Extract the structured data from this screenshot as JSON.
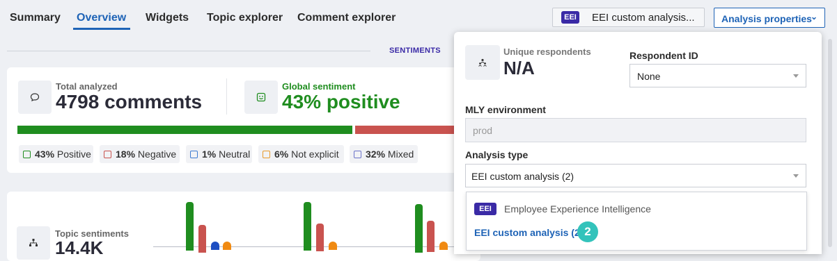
{
  "nav": {
    "tabs": [
      {
        "label": "Summary"
      },
      {
        "label": "Overview",
        "active": true
      },
      {
        "label": "Widgets"
      },
      {
        "label": "Topic explorer"
      },
      {
        "label": "Comment explorer"
      }
    ],
    "context_badge": "EEI",
    "context_text": "EEI custom analysis...",
    "properties_button": "Analysis properties",
    "properties_chevron": "⌄"
  },
  "section_label": "SENTIMENTS",
  "summary_card": {
    "total_label": "Total analyzed",
    "total_value": "4798 comments",
    "global_label": "Global sentiment",
    "global_value": "43% positive",
    "bar": [
      {
        "name": "positive",
        "value": 43,
        "color": "#1f8d1f"
      },
      {
        "name": "negative",
        "value": 18,
        "color": "#c9534f"
      }
    ],
    "chips": [
      {
        "percent": "43%",
        "label": "Positive",
        "color": "#1f8d1f"
      },
      {
        "percent": "18%",
        "label": "Negative",
        "color": "#c9534f"
      },
      {
        "percent": "1%",
        "label": "Neutral",
        "color": "#3d7bd1"
      },
      {
        "percent": "6%",
        "label": "Not explicit",
        "color": "#e89a2a"
      },
      {
        "percent": "32%",
        "label": "Mixed",
        "color": "#6b73c9"
      }
    ]
  },
  "topic_card": {
    "label": "Topic sentiments",
    "value": "14.4K",
    "colors": {
      "positive": "#1f8d1f",
      "negative": "#c9534f",
      "neutral": "#1e4fc2",
      "not_explicit": "#f08a12"
    }
  },
  "panel": {
    "unique_label": "Unique respondents",
    "unique_value": "N/A",
    "respondent_id_label": "Respondent ID",
    "respondent_id_value": "None",
    "env_label": "MLY environment",
    "env_value": "prod",
    "analysis_type_label": "Analysis type",
    "analysis_type_value": "EEI custom analysis (2)",
    "options": [
      {
        "badge": "EEI",
        "label": "Employee Experience Intelligence"
      },
      {
        "label": "EEI custom analysis (2)",
        "selected": true
      }
    ],
    "step_number": "2"
  }
}
